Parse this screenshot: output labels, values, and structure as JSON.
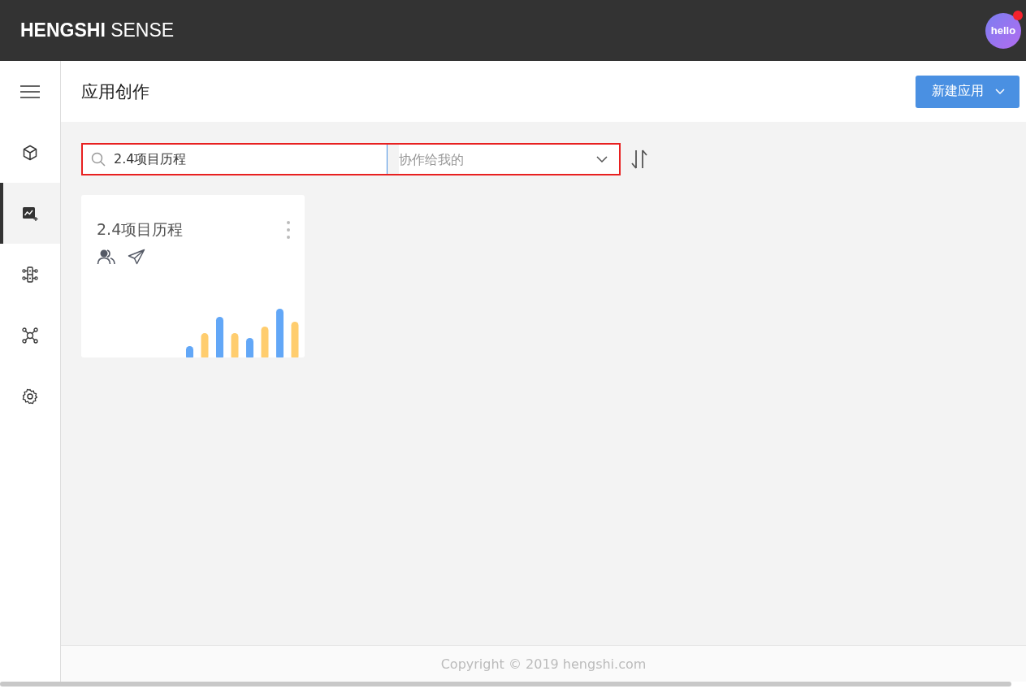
{
  "header": {
    "logo": "**HENGSHI** SENSE",
    "avatar_text": "hello",
    "notification_dot": true
  },
  "sidebar": {
    "items": [
      {
        "kind": "cube",
        "selected": false
      },
      {
        "kind": "chart",
        "selected": true
      },
      {
        "kind": "model",
        "selected": false
      },
      {
        "kind": "network",
        "selected": false
      },
      {
        "kind": "settings",
        "selected": false
      }
    ]
  },
  "page": {
    "title": "应用创作",
    "new_button": "新建应用"
  },
  "filters": {
    "search_value": "2.4项目历程",
    "scope_placeholder": "协作给我的"
  },
  "apps": [
    {
      "title": "2.4项目历程"
    }
  ],
  "footer": "Copyright © 2019 hengshi.com"
}
